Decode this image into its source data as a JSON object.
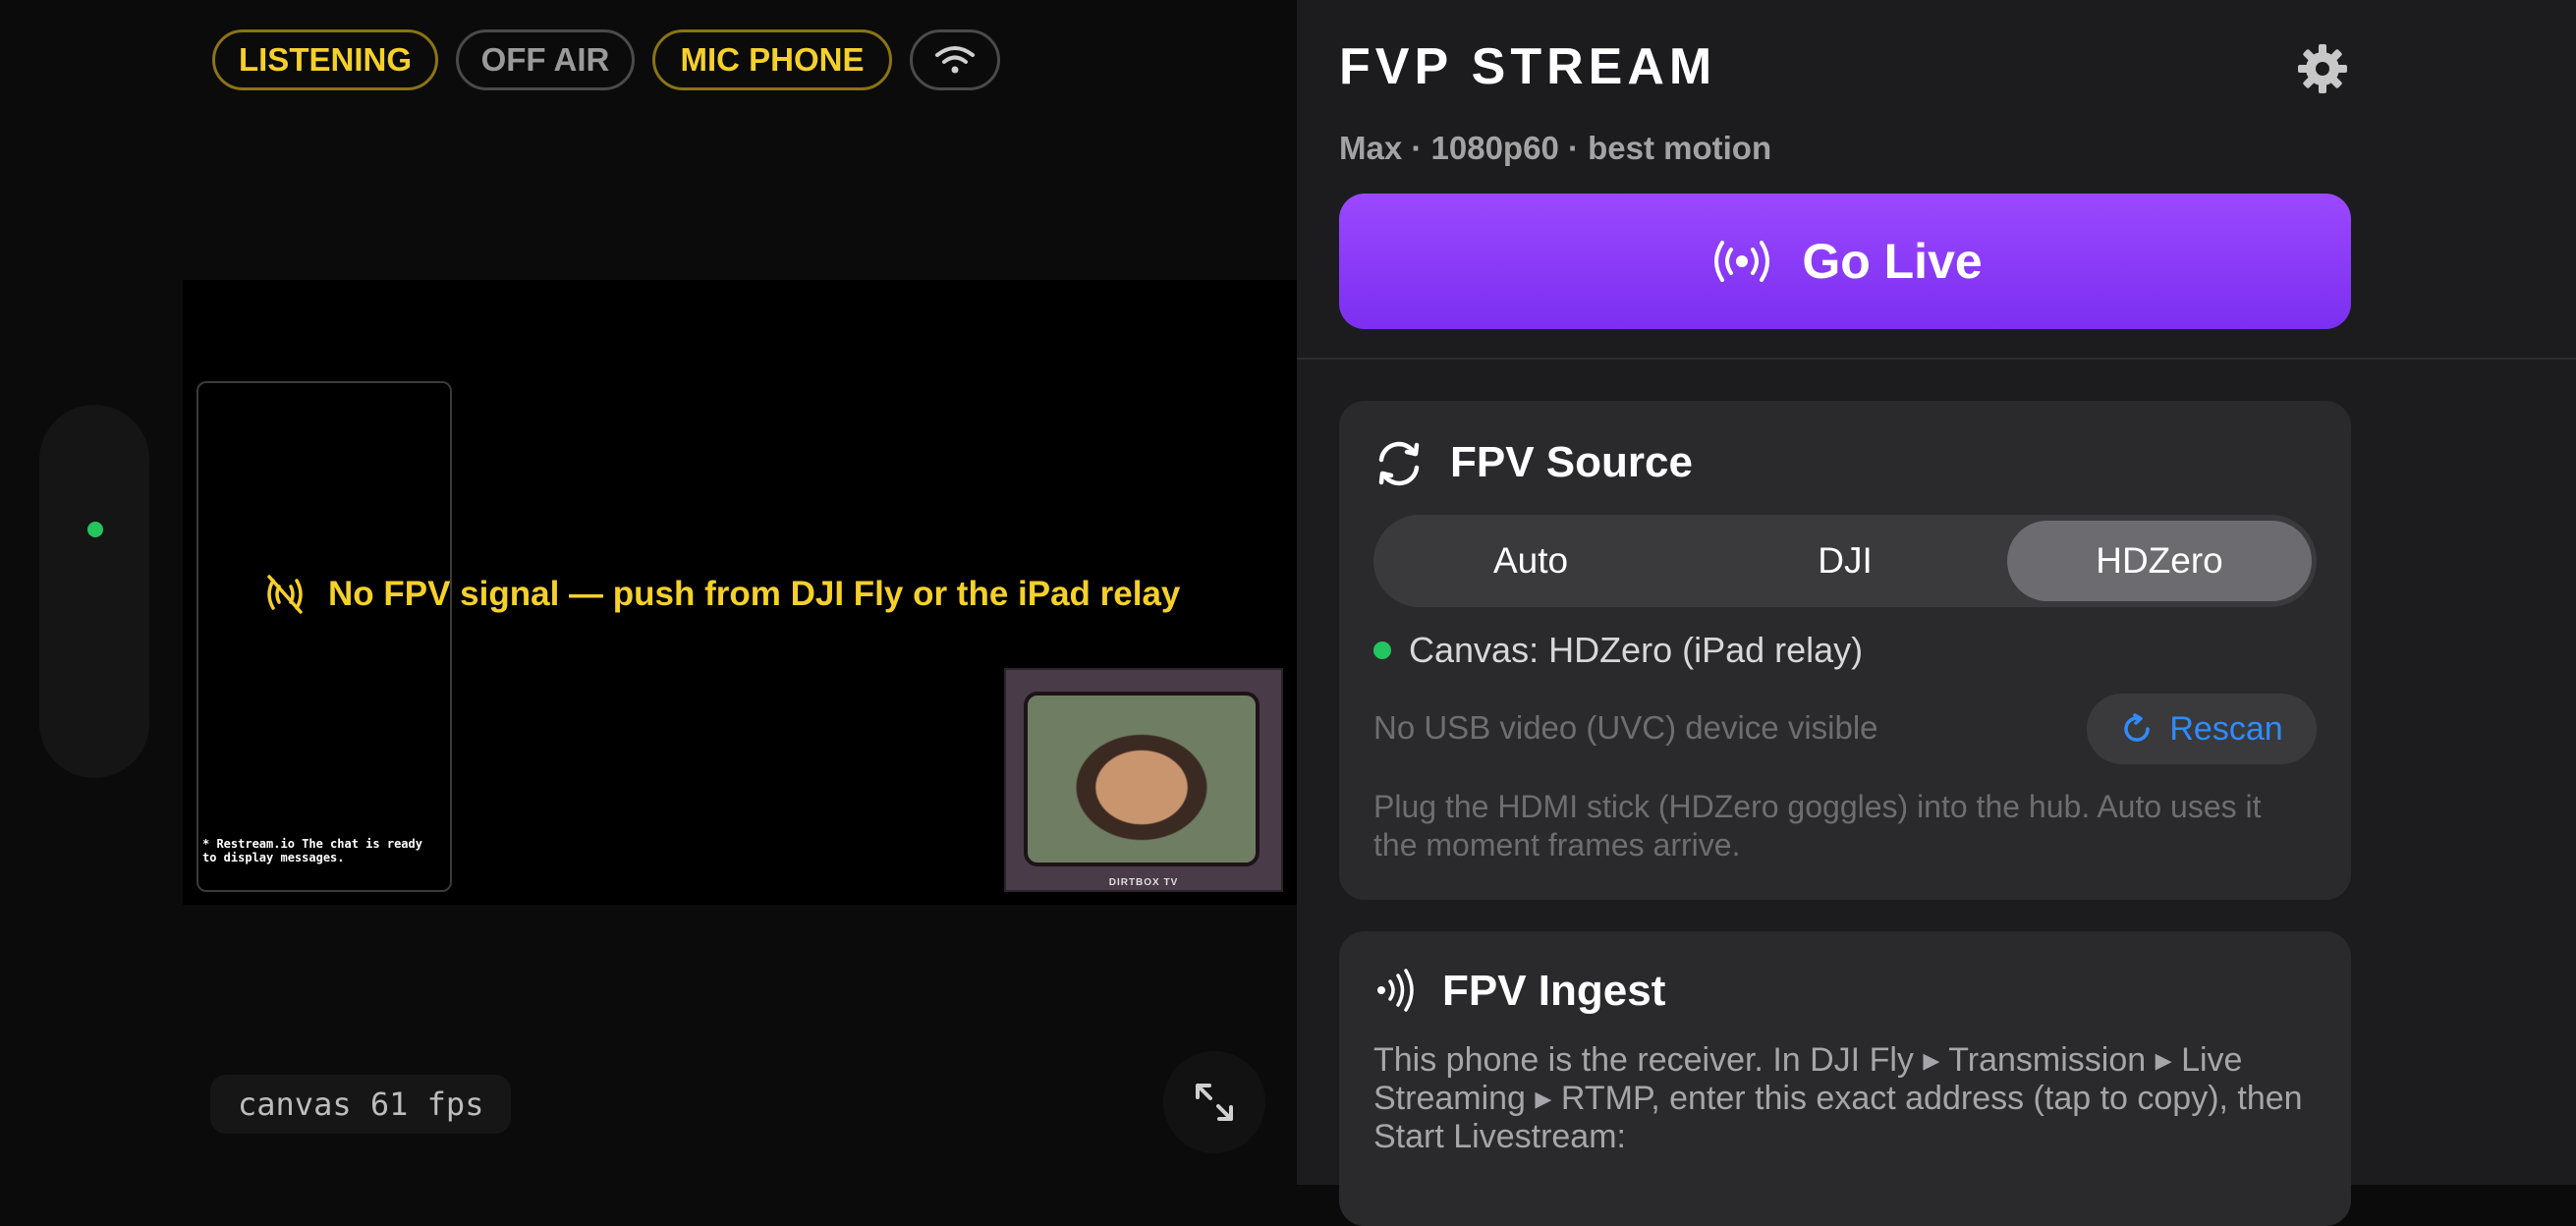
{
  "status_pills": {
    "listening": "LISTENING",
    "off_air": "OFF AIR",
    "mic_phone": "MIC PHONE",
    "wifi_icon": "wifi-icon"
  },
  "preview": {
    "no_signal": "No FPV signal — push from DJI Fly or the iPad relay",
    "chat_message": "* Restream.io The chat is ready to display messages.",
    "camera_brand": "DIRTBOX TV",
    "fps_label": "canvas 61 fps"
  },
  "header": {
    "title": "FVP STREAM",
    "subtitle": "Max · 1080p60 · best motion",
    "go_live": "Go Live"
  },
  "source_card": {
    "title": "FPV Source",
    "segments": [
      "Auto",
      "DJI",
      "HDZero"
    ],
    "selected": "HDZero",
    "canvas_status": "Canvas: HDZero (iPad relay)",
    "usb_status": "No USB video (UVC) device visible",
    "rescan": "Rescan",
    "help": "Plug the HDMI stick (HDZero goggles) into the hub. Auto uses it the moment frames arrive."
  },
  "ingest_card": {
    "title": "FPV Ingest",
    "help": "This phone is the receiver. In DJI Fly ▸ Transmission ▸ Live Streaming ▸ RTMP, enter this exact address (tap to copy), then Start Livestream:"
  },
  "colors": {
    "accent_yellow": "#f5d02b",
    "live_purple": "#8b3cf7",
    "status_green": "#22c55e",
    "link_blue": "#2f8cff"
  }
}
